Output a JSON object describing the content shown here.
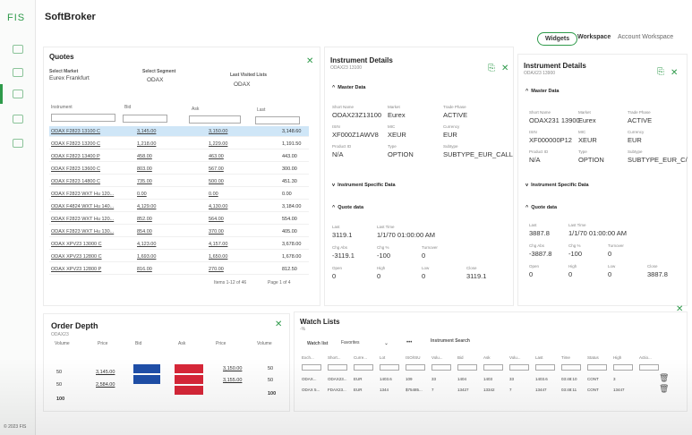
{
  "app": {
    "logo": "FIS",
    "title": "SoftBroker"
  },
  "topbar": {
    "widgets_label": "Widgets",
    "workspace_label": "Workspace",
    "workspace_value": "Account Workspace"
  },
  "quotes": {
    "title": "Quotes",
    "select_market_label": "Select Market",
    "select_market_value": "Eurex Frankfurt",
    "select_segment_label": "Select Segment",
    "select_segment_value": "ODAX",
    "last_visited_label": "Last Visited Lists",
    "last_visited_value": "ODAX",
    "columns": [
      "Instrument",
      "Bid",
      "Ask",
      "Last"
    ],
    "rows": [
      {
        "instrument": "ODAX F2823 13100 C",
        "bid": "3,145.00",
        "ask": "3,150.00",
        "last": "3,148.60"
      },
      {
        "instrument": "ODAX F2823 13200 C",
        "bid": "1,218.00",
        "ask": "1,229.00",
        "last": "1,191.50"
      },
      {
        "instrument": "ODAX F2823 13400 P",
        "bid": "458.00",
        "ask": "463.00",
        "last": "443.00"
      },
      {
        "instrument": "ODAX F2823 13600 C",
        "bid": "803.00",
        "ask": "567.00",
        "last": "300.00"
      },
      {
        "instrument": "ODAX F2823 14800 C",
        "bid": "735.00",
        "ask": "500.00",
        "last": "451.30"
      },
      {
        "instrument": "ODAX F2823 WXT Hu 120...",
        "bid": "0.00",
        "ask": "0.00",
        "last": "0.00"
      },
      {
        "instrument": "ODAX F4824 WXT Hu 140...",
        "bid": "4,129.00",
        "ask": "4,130.00",
        "last": "3,184.00"
      },
      {
        "instrument": "ODAX F2823 WXT Hu 120...",
        "bid": "852.00",
        "ask": "564.00",
        "last": "554.00"
      },
      {
        "instrument": "ODAX F2823 WXT Hu 130...",
        "bid": "854.00",
        "ask": "370.00",
        "last": "405.00"
      },
      {
        "instrument": "ODAX XPV23 13000 C",
        "bid": "4,123.00",
        "ask": "4,157.00",
        "last": "3,678.00"
      },
      {
        "instrument": "ODAX XPV23 12800 C",
        "bid": "1,693.00",
        "ask": "1,650.00",
        "last": "1,678.00"
      },
      {
        "instrument": "ODAX XPV23 12800 P",
        "bid": "816.00",
        "ask": "270.00",
        "last": "812.50"
      }
    ],
    "pager": "Items 1-12 of 46",
    "page": "Page 1 of 4"
  },
  "details1": {
    "title": "Instrument Details",
    "subtitle": "ODAX23 13100",
    "master": "Master Data",
    "spec": "Instrument Specific Data",
    "quote": "Quote data",
    "fields": [
      {
        "label": "Short Name",
        "value": "ODAX23Z13100"
      },
      {
        "label": "Market",
        "value": "Eurex"
      },
      {
        "label": "Trade Phase",
        "value": "ACTIVE"
      },
      {
        "label": "ISIN",
        "value": "XF000Z1AWV8"
      },
      {
        "label": "MIC",
        "value": "XEUR"
      },
      {
        "label": "Currency",
        "value": "EUR"
      },
      {
        "label": "Product ID",
        "value": "N/A"
      },
      {
        "label": "Type",
        "value": "OPTION"
      },
      {
        "label": "Subtype",
        "value": "SUBTYPE_EUR_CALL"
      }
    ],
    "quotefields": [
      {
        "label": "Last",
        "value": "3119.1"
      },
      {
        "label": "Last Time",
        "value": "1/1/70 01:00:00 AM"
      },
      {
        "label": "Chg Abs",
        "value": "-3119.1"
      },
      {
        "label": "Chg %",
        "value": "-100"
      },
      {
        "label": "Turnover",
        "value": "0"
      },
      {
        "label": "Open",
        "value": "0"
      },
      {
        "label": "High",
        "value": "0"
      },
      {
        "label": "Low",
        "value": "0"
      },
      {
        "label": "Close",
        "value": "3119.1"
      }
    ]
  },
  "details2": {
    "title": "Instrument Details",
    "subtitle": "ODAX23 13900",
    "master": "Master Data",
    "spec": "Instrument Specific Data",
    "quote": "Quote data",
    "fields": [
      {
        "label": "Short Name",
        "value": "ODAX231 13900"
      },
      {
        "label": "Market",
        "value": "Eurex"
      },
      {
        "label": "Trade Phase",
        "value": "ACTIVE"
      },
      {
        "label": "ISIN",
        "value": "XF000000P12"
      },
      {
        "label": "MIC",
        "value": "XEUR"
      },
      {
        "label": "Currency",
        "value": "EUR"
      },
      {
        "label": "Product ID",
        "value": "N/A"
      },
      {
        "label": "Type",
        "value": "OPTION"
      },
      {
        "label": "Subtype",
        "value": "SUBTYPE_EUR_C/"
      }
    ],
    "quotefields": [
      {
        "label": "Last",
        "value": "3887.8"
      },
      {
        "label": "Last Time",
        "value": "1/1/70 01:00:00 AM"
      },
      {
        "label": "Chg Abs",
        "value": "-3887.8"
      },
      {
        "label": "Chg %",
        "value": "-100"
      },
      {
        "label": "Turnover",
        "value": "0"
      },
      {
        "label": "Open",
        "value": "0"
      },
      {
        "label": "High",
        "value": "0"
      },
      {
        "label": "Low",
        "value": "0"
      },
      {
        "label": "Close",
        "value": "3887.8"
      }
    ]
  },
  "orderdepth": {
    "title": "Order Depth",
    "subtitle": "ODAX23",
    "columns": [
      "Volume",
      "Price",
      "Bid",
      "Ask",
      "Price",
      "Volume"
    ],
    "rows": [
      {
        "bvol": "50",
        "bprice": "3,145.00",
        "aprice": "3,150.00",
        "avol": "50"
      },
      {
        "bvol": "50",
        "bprice": "2,584.00",
        "aprice": "3,155.00",
        "avol": "50"
      }
    ],
    "total_bid": "100",
    "total_ask": "100"
  },
  "watchlist": {
    "title": "Watch Lists",
    "subtitle": "-%",
    "tab_label": "Watch list",
    "tab_value": "Favorites",
    "search_label": "Instrument Search",
    "columns": [
      "Exch...",
      "Short...",
      "Curre...",
      "Lot",
      "ISO/ISU",
      "Volu...",
      "Bid",
      "Ask",
      "Volu...",
      "Last",
      "Time",
      "Status",
      "High",
      "Actio..."
    ],
    "rows": [
      [
        "ODAX...",
        "ODAX23...",
        "EUR",
        "1403.6",
        "109",
        "33",
        "1404",
        "1403",
        "33",
        "1403.6",
        "03:48:10",
        "CONT",
        "3"
      ],
      [
        "ODAX 5...",
        "FDAX23...",
        "EUR",
        "1344",
        "$75485...",
        "7",
        "13427",
        "13342",
        "7",
        "13447",
        "03:48:11",
        "CONT",
        "13447"
      ]
    ]
  },
  "footer": {
    "copyright": "© 2023 FIS"
  },
  "colors": {
    "accent": "#2e9a4a",
    "bid": "#1f4fa8",
    "ask": "#d72638",
    "selected": "#cfe6f7"
  }
}
